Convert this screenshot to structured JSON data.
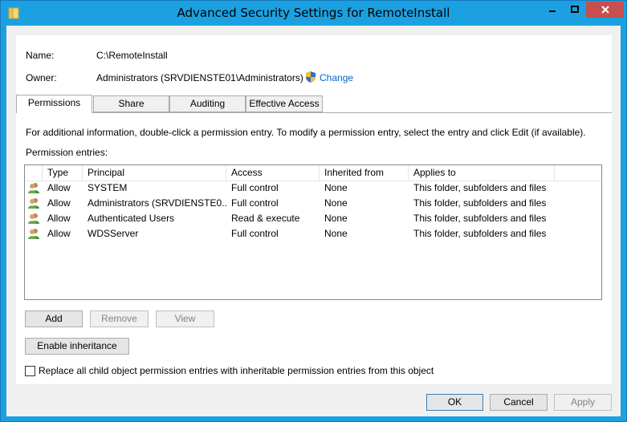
{
  "window": {
    "title": "Advanced Security Settings for RemoteInstall",
    "accent": "#1ba1e2"
  },
  "info": {
    "name_label": "Name:",
    "name_value": "C:\\RemoteInstall",
    "owner_label": "Owner:",
    "owner_value": "Administrators (SRVDIENSTE01\\Administrators)",
    "change_link": "Change"
  },
  "tabs": [
    {
      "label": "Permissions",
      "active": true
    },
    {
      "label": "Share",
      "active": false
    },
    {
      "label": "Auditing",
      "active": false
    },
    {
      "label": "Effective Access",
      "active": false
    }
  ],
  "permissions": {
    "info_text": "For additional information, double-click a permission entry. To modify a permission entry, select the entry and click Edit (if available).",
    "entries_label": "Permission entries:",
    "columns": [
      "Type",
      "Principal",
      "Access",
      "Inherited from",
      "Applies to"
    ],
    "rows": [
      {
        "type": "Allow",
        "principal": "SYSTEM",
        "access": "Full control",
        "inherited": "None",
        "applies": "This folder, subfolders and files"
      },
      {
        "type": "Allow",
        "principal": "Administrators (SRVDIENSTE0...",
        "access": "Full control",
        "inherited": "None",
        "applies": "This folder, subfolders and files"
      },
      {
        "type": "Allow",
        "principal": "Authenticated Users",
        "access": "Read & execute",
        "inherited": "None",
        "applies": "This folder, subfolders and files"
      },
      {
        "type": "Allow",
        "principal": "WDSServer",
        "access": "Full control",
        "inherited": "None",
        "applies": "This folder, subfolders and files"
      }
    ],
    "add_label": "Add",
    "remove_label": "Remove",
    "view_label": "View",
    "enable_inheritance_label": "Enable inheritance",
    "replace_label": "Replace all child object permission entries with inheritable permission entries from this object"
  },
  "footer": {
    "ok_label": "OK",
    "cancel_label": "Cancel",
    "apply_label": "Apply"
  },
  "icons": {
    "title": "folder-icon",
    "minimize": "minimize-icon",
    "maximize": "maximize-icon",
    "close": "close-icon",
    "change": "uac-shield-icon",
    "entry": "user-group-icon"
  }
}
